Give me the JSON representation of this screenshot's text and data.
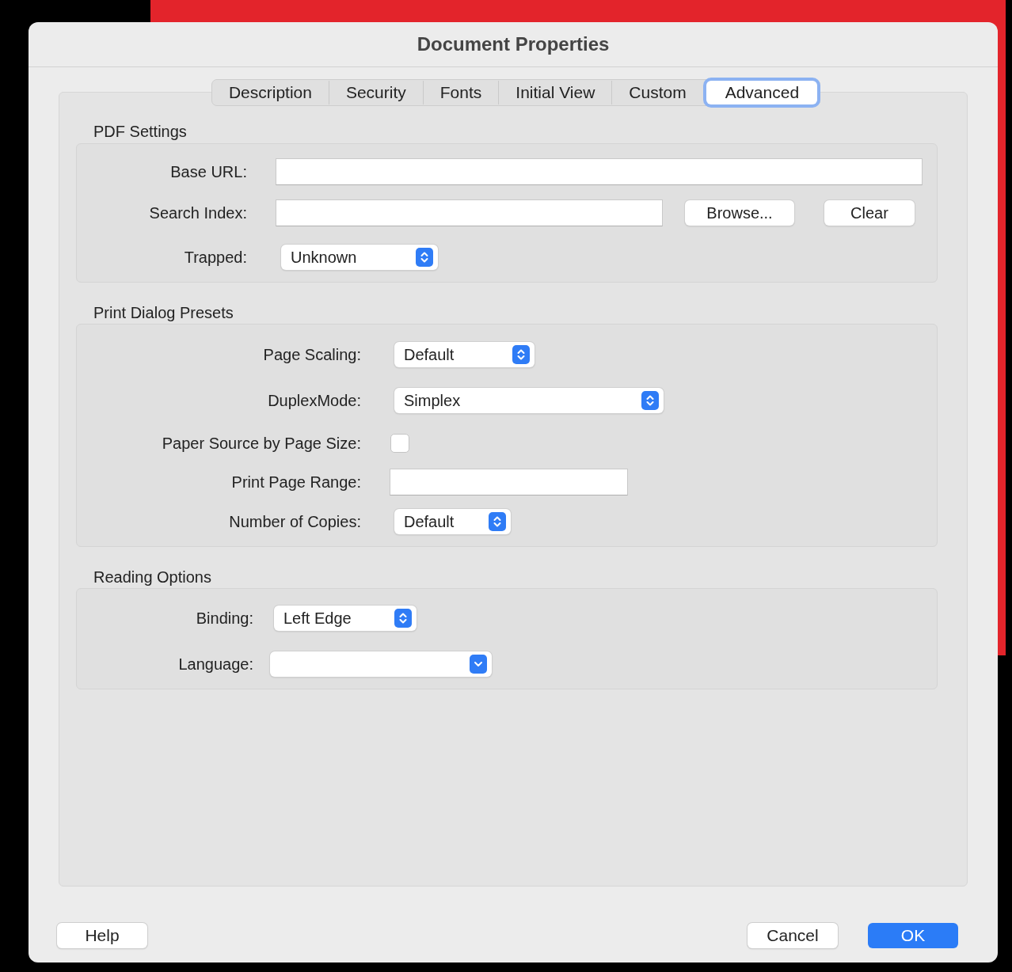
{
  "window": {
    "title": "Document Properties"
  },
  "tabs": [
    {
      "label": "Description",
      "selected": false
    },
    {
      "label": "Security",
      "selected": false
    },
    {
      "label": "Fonts",
      "selected": false
    },
    {
      "label": "Initial View",
      "selected": false
    },
    {
      "label": "Custom",
      "selected": false
    },
    {
      "label": "Advanced",
      "selected": true
    }
  ],
  "sections": [
    {
      "title": "PDF Settings",
      "rows": [
        {
          "kind": "text",
          "label": "Base URL:"
        },
        {
          "kind": "text",
          "label": "Search Index:",
          "buttons": [
            "Browse...",
            "Clear"
          ]
        },
        {
          "kind": "popup",
          "label": "Trapped:",
          "value": "Unknown"
        }
      ]
    },
    {
      "title": "Print Dialog Presets",
      "rows": [
        {
          "kind": "popup",
          "label": "Page Scaling:",
          "value": "Default"
        },
        {
          "kind": "popup",
          "label": "DuplexMode:",
          "value": "Simplex"
        },
        {
          "kind": "checkbox",
          "label": "Paper Source by Page Size:",
          "checked": false
        },
        {
          "kind": "text",
          "label": "Print Page Range:"
        },
        {
          "kind": "popup",
          "label": "Number of Copies:",
          "value": "Default"
        }
      ]
    },
    {
      "title": "Reading Options",
      "rows": [
        {
          "kind": "popup",
          "label": "Binding:",
          "value": "Left Edge"
        },
        {
          "kind": "dropdown",
          "label": "Language:"
        }
      ]
    }
  ],
  "buttons": [
    {
      "label": "Help",
      "default": false
    },
    {
      "label": "Cancel",
      "default": false
    },
    {
      "label": "OK",
      "default": true
    }
  ]
}
